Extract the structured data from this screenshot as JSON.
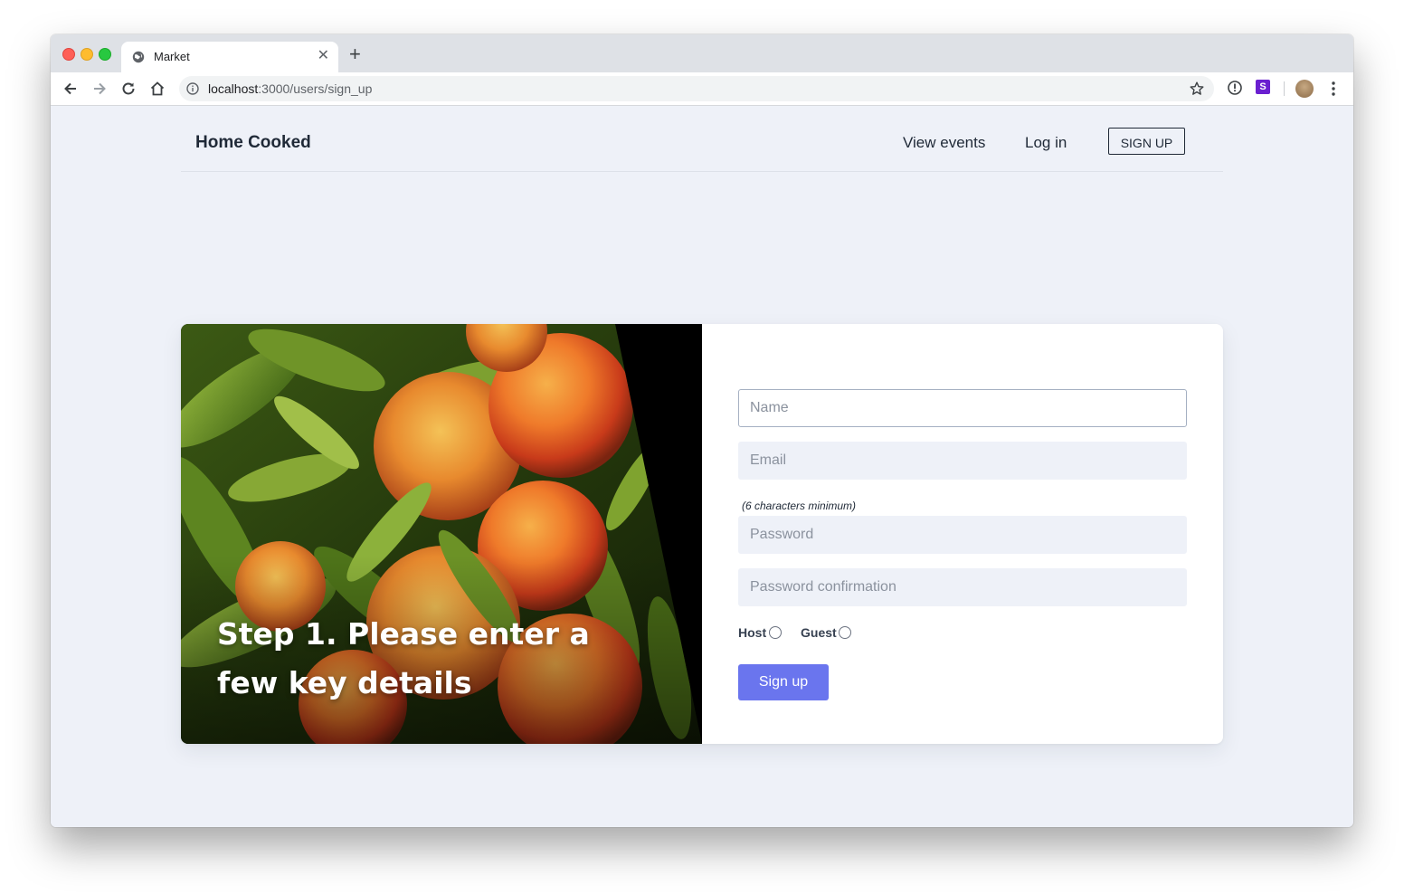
{
  "browser": {
    "tab_title": "Market",
    "tab_close": "✕",
    "new_tab": "+",
    "url_host": "localhost",
    "url_path": ":3000/users/sign_up",
    "extension_s_label": "S"
  },
  "nav": {
    "brand": "Home Cooked",
    "links": [
      {
        "label": "View events"
      },
      {
        "label": "Log in"
      }
    ],
    "signup_label": "SIGN UP"
  },
  "hero": {
    "heading": "Step 1. Please enter a few key details"
  },
  "form": {
    "name_placeholder": "Name",
    "email_placeholder": "Email",
    "password_hint": "(6 characters minimum)",
    "password_placeholder": "Password",
    "confirm_placeholder": "Password confirmation",
    "roles": [
      {
        "label": "Host",
        "selected": false
      },
      {
        "label": "Guest",
        "selected": false
      }
    ],
    "submit_label": "Sign up"
  },
  "colors": {
    "page_bg": "#eef1f8",
    "accent": "#6a75ee",
    "text": "#1f2937"
  }
}
